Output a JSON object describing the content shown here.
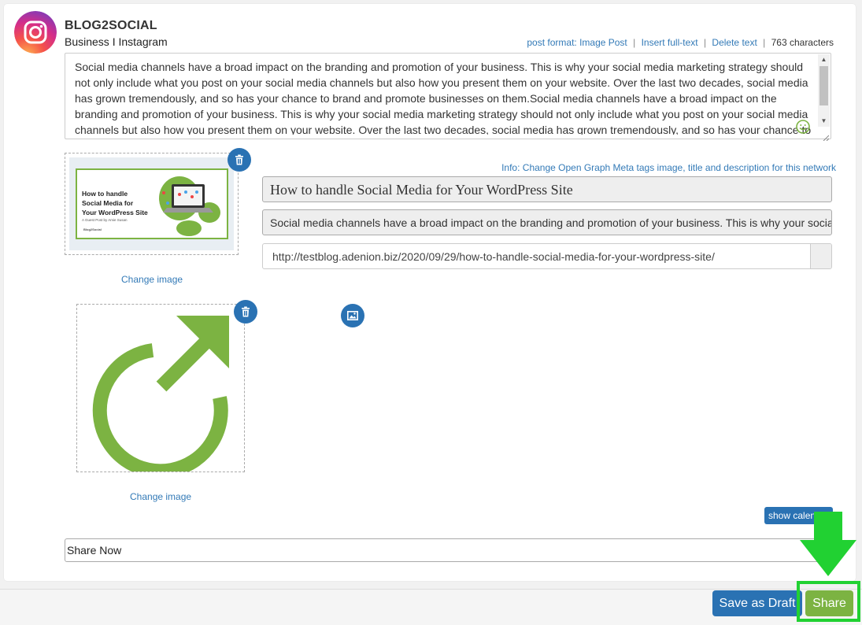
{
  "network": {
    "name": "BLOG2SOCIAL",
    "type": "Business I Instagram",
    "icon": "instagram-icon"
  },
  "post_tools": {
    "format_link": "post format: Image Post",
    "insert_link": "Insert full-text",
    "delete_link": "Delete text",
    "char_count": "763 characters",
    "separator": "|"
  },
  "editor": {
    "text": "Social media channels have a broad impact on the branding and promotion of your business. This is why your social media marketing strategy should not only include what you post on your social media channels but also how you present them on your website. Over the last two decades, social media has grown tremendously, and so has your chance to brand and promote businesses on them.Social media channels have a broad impact on the branding and promotion of your business. This is why your social media marketing strategy should not only include what you post on your social media channels but also how you present them on your website. Over the last two decades, social media has grown tremendously, and so has your chance to brand and promote businesses on them."
  },
  "preview_image": {
    "title_line1": "How to handle",
    "title_line2": "Social Media for",
    "title_line3": "Your WordPress Site",
    "byline": "A Guest Post by Amie Susan",
    "logo_text": "Blog2Social"
  },
  "change_image_1": "Change image",
  "change_image_2": "Change image",
  "og": {
    "info": "Info: Change Open Graph Meta tags image, title and description for this network",
    "title": "How to handle Social Media for Your WordPress Site",
    "description": "Social media channels have a broad impact on the branding and promotion of your business. This is why your social media marketing strategy",
    "url": "http://testblog.adenion.biz/2020/09/29/how-to-handle-social-media-for-your-wordpress-site/"
  },
  "calendar_button": "show calendar",
  "share_select": {
    "value": "Share Now"
  },
  "footer": {
    "draft_button": "Save as Draft",
    "share_button": "Share"
  },
  "colors": {
    "primary": "#2a72b3",
    "share_green": "#7cb342",
    "highlight_green": "#21d132",
    "icon_green": "#7cb342"
  }
}
